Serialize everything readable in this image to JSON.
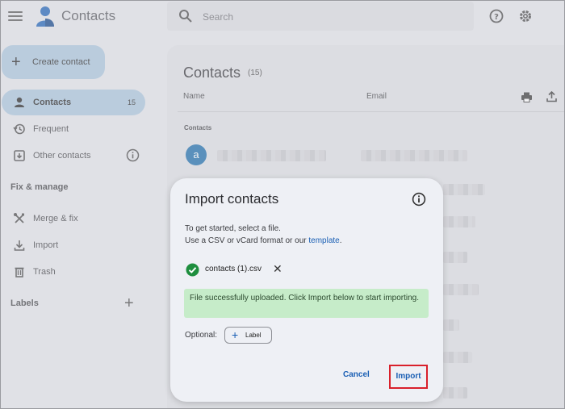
{
  "header": {
    "app_title": "Contacts",
    "search_placeholder": "Search",
    "icons": [
      "menu-icon",
      "contacts-logo",
      "search-icon",
      "help-icon",
      "gear-icon"
    ]
  },
  "sidebar": {
    "create_label": "Create contact",
    "items": [
      {
        "label": "Contacts",
        "count": "15",
        "active": true,
        "icon": "person-icon"
      },
      {
        "label": "Frequent",
        "icon": "history-icon"
      },
      {
        "label": "Other contacts",
        "icon": "inbox-download-icon",
        "info": true
      }
    ],
    "fix_title": "Fix & manage",
    "fix_items": [
      {
        "label": "Merge & fix",
        "icon": "wrench-icon"
      },
      {
        "label": "Import",
        "icon": "download-icon"
      },
      {
        "label": "Trash",
        "icon": "trash-icon"
      }
    ],
    "labels_title": "Labels"
  },
  "main": {
    "title": "Contacts",
    "count": "(15)",
    "col_name": "Name",
    "col_email": "Email",
    "section_heading": "Contacts",
    "first_avatar_letter": "a"
  },
  "dialog": {
    "title": "Import contacts",
    "line1": "To get started, select a file.",
    "line2_prefix": "Use a CSV or vCard format or our ",
    "line2_link": "template",
    "line2_suffix": ".",
    "file_name": "contacts (1).csv",
    "success_message": "File successfully uploaded. Click Import below to start importing.",
    "optional_label": "Optional:",
    "label_chip": "Label",
    "cancel_label": "Cancel",
    "import_label": "Import"
  },
  "colors": {
    "accent_blue": "#1a5fb4",
    "active_nav": "#a8c4db",
    "success_bg": "#c6ecc9",
    "highlight_red": "#d9202b",
    "avatar_blue": "#1468a8"
  }
}
